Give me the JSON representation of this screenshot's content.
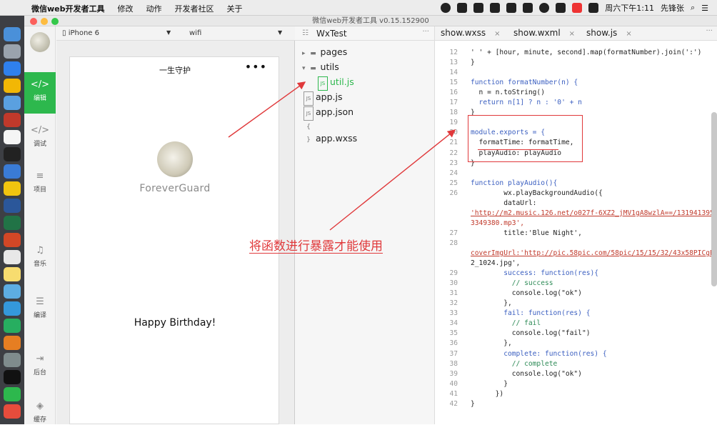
{
  "menubar": {
    "apple_glyph": "",
    "app_name": "微信web开发者工具",
    "menus": [
      "修改",
      "动作",
      "开发者社区",
      "关于"
    ],
    "clock": "周六下午1:11",
    "user": "先锋张"
  },
  "window": {
    "title": "微信web开发者工具 v0.15.152900",
    "traffic_colors": [
      "#fc605c",
      "#fdbc40",
      "#34c84a"
    ]
  },
  "sidebar": {
    "items": [
      {
        "label": "编辑",
        "icon": "code-icon",
        "active": true
      },
      {
        "label": "调试",
        "icon": "debug-icon",
        "active": false
      },
      {
        "label": "项目",
        "icon": "project-icon",
        "active": false
      },
      {
        "label": "音乐",
        "icon": "music-icon",
        "active": false
      },
      {
        "label": "编译",
        "icon": "compile-icon",
        "active": false
      },
      {
        "label": "后台",
        "icon": "background-icon",
        "active": false
      },
      {
        "label": "缓存",
        "icon": "cache-icon",
        "active": false
      }
    ],
    "accent": "#2db84d"
  },
  "simulator": {
    "device": "iPhone 6",
    "network": "wifi",
    "page_title": "一生守护",
    "menu_dots": "•••",
    "name": "ForeverGuard",
    "song": "Happy Birthday!"
  },
  "tree": {
    "project": "WxTest",
    "more": "···",
    "items": [
      {
        "label": "pages",
        "icon": "folder-icon",
        "toggle": "▸"
      },
      {
        "label": "utils",
        "icon": "folder-icon",
        "toggle": "▾"
      },
      {
        "label": "util.js",
        "icon": "js-file-icon",
        "badge": "JS",
        "selected": true
      },
      {
        "label": "app.js",
        "icon": "js-file-icon",
        "badge": "JS"
      },
      {
        "label": "app.json",
        "icon": "json-file-icon",
        "badge": "JS"
      },
      {
        "label": "app.wxss",
        "icon": "wxss-file-icon",
        "badge": "{ }"
      }
    ]
  },
  "editor": {
    "tabs": [
      {
        "label": "show.wxss",
        "close": "×"
      },
      {
        "label": "show.wxml",
        "close": "×"
      },
      {
        "label": "show.js",
        "close": "×"
      }
    ],
    "more": "···",
    "lines": [
      {
        "n": "12",
        "t": "' ' + [hour, minute, second].map(formatNumber).join(':')"
      },
      {
        "n": "13",
        "t": "}"
      },
      {
        "n": "14",
        "t": ""
      },
      {
        "n": "15",
        "t": "function formatNumber(n) {"
      },
      {
        "n": "16",
        "t": "  n = n.toString()"
      },
      {
        "n": "17",
        "t": "  return n[1] ? n : '0' + n"
      },
      {
        "n": "18",
        "t": "}"
      },
      {
        "n": "19",
        "t": ""
      },
      {
        "n": "20",
        "t": "module.exports = {"
      },
      {
        "n": "21",
        "t": "  formatTime: formatTime,"
      },
      {
        "n": "22",
        "t": "  playAudio: playAudio"
      },
      {
        "n": "23",
        "t": "}"
      },
      {
        "n": "24",
        "t": ""
      },
      {
        "n": "25",
        "t": "function playAudio(){"
      },
      {
        "n": "26",
        "t": "        wx.playBackgroundAudio({"
      },
      {
        "n": "",
        "t": "        dataUrl:"
      },
      {
        "n": "",
        "t": "'http://m2.music.126.net/o027f-6XZ2_jMV1gA8wzlA==/131941395"
      },
      {
        "n": "",
        "t": "3349380.mp3',"
      },
      {
        "n": "27",
        "t": "        title:'Blue Night',"
      },
      {
        "n": "28",
        "t": ""
      },
      {
        "n": "",
        "t": "coverImgUrl:'http://pic.58pic.com/58pic/15/15/32/43x58PICgE"
      },
      {
        "n": "",
        "t": "2_1024.jpg',"
      },
      {
        "n": "29",
        "t": "        success: function(res){"
      },
      {
        "n": "30",
        "t": "          // success"
      },
      {
        "n": "31",
        "t": "          console.log(\"ok\")"
      },
      {
        "n": "32",
        "t": "        },"
      },
      {
        "n": "33",
        "t": "        fail: function(res) {"
      },
      {
        "n": "34",
        "t": "          // fail"
      },
      {
        "n": "35",
        "t": "          console.log(\"fail\")"
      },
      {
        "n": "36",
        "t": "        },"
      },
      {
        "n": "37",
        "t": "        complete: function(res) {"
      },
      {
        "n": "38",
        "t": "          // complete"
      },
      {
        "n": "39",
        "t": "          console.log(\"ok\")"
      },
      {
        "n": "40",
        "t": "        }"
      },
      {
        "n": "41",
        "t": "      })"
      },
      {
        "n": "42",
        "t": "}"
      }
    ]
  },
  "annotation": {
    "text": "将函数进行暴露才能使用",
    "color": "#e0393b"
  }
}
